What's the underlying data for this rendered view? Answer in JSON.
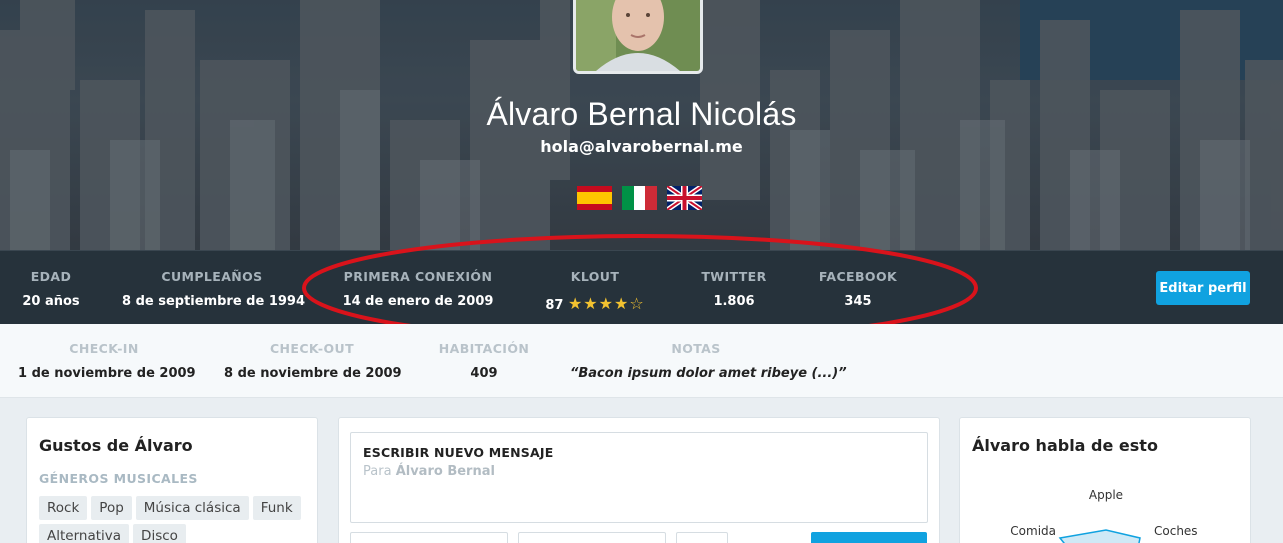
{
  "profile": {
    "name": "Álvaro Bernal Nicolás",
    "email": "hola@alvarobernal.me",
    "flags": [
      "spain-flag-icon",
      "italy-flag-icon",
      "uk-flag-icon"
    ]
  },
  "stats": [
    {
      "label": "EDAD",
      "value": "20 años"
    },
    {
      "label": "CUMPLEAÑOS",
      "value": "8 de septiembre de 1994"
    },
    {
      "label": "PRIMERA CONEXIÓN",
      "value": "14 de enero de 2009"
    },
    {
      "label": "KLOUT",
      "value": "87",
      "stars": "★★★★☆",
      "rating": 4
    },
    {
      "label": "TWITTER",
      "value": "1.806"
    },
    {
      "label": "FACEBOOK",
      "value": "345"
    }
  ],
  "edit_button": "Editar perfil",
  "booking": [
    {
      "label": "CHECK-IN",
      "value": "1 de noviembre de 2009"
    },
    {
      "label": "CHECK-OUT",
      "value": "8 de noviembre de 2009"
    },
    {
      "label": "HABITACIÓN",
      "value": "409"
    },
    {
      "label": "NOTAS",
      "value": "“Bacon ipsum dolor amet ribeye (...)”"
    }
  ],
  "likes": {
    "title": "Gustos de Álvaro",
    "section": "GÉNEROS MUSICALES",
    "tags": [
      "Rock",
      "Pop",
      "Música clásica",
      "Funk",
      "Alternativa",
      "Disco"
    ]
  },
  "message": {
    "title": "ESCRIBIR NUEVO MENSAJE",
    "to_prefix": "Para",
    "to_name": "Álvaro Bernal"
  },
  "talks": {
    "title": "Álvaro habla de esto",
    "axes": [
      "Apple",
      "Coches",
      "Comida"
    ]
  },
  "colors": {
    "accent": "#10a2e0",
    "stats_bg": "#26323b",
    "annotation": "#d9131b"
  }
}
